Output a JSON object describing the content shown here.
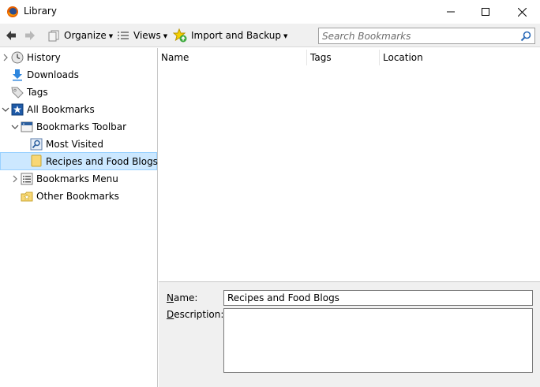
{
  "window": {
    "title": "Library",
    "controls": [
      "minimize",
      "maximize",
      "close"
    ]
  },
  "toolbar": {
    "back_icon": "back-arrow-icon",
    "forward_icon": "forward-arrow-icon",
    "organize_label": "Organize",
    "views_label": "Views",
    "import_label": "Import and Backup",
    "search_placeholder": "Search Bookmarks"
  },
  "tree": {
    "items": [
      {
        "label": "History",
        "icon": "history-clock-icon",
        "twisty": "collapsed"
      },
      {
        "label": "Downloads",
        "icon": "download-arrow-icon",
        "twisty": "none"
      },
      {
        "label": "Tags",
        "icon": "tag-icon",
        "twisty": "none"
      },
      {
        "label": "All Bookmarks",
        "icon": "bookmarks-star-icon",
        "twisty": "expanded"
      },
      {
        "label": "Bookmarks Toolbar",
        "icon": "bookmarks-toolbar-icon",
        "twisty": "expanded"
      },
      {
        "label": "Most Visited",
        "icon": "smart-query-icon",
        "twisty": "none"
      },
      {
        "label": "Recipes and Food Blogs",
        "icon": "folder-icon",
        "twisty": "none",
        "selected": true
      },
      {
        "label": "Bookmarks Menu",
        "icon": "bookmarks-menu-icon",
        "twisty": "collapsed"
      },
      {
        "label": "Other Bookmarks",
        "icon": "other-bookmarks-icon",
        "twisty": "none"
      }
    ]
  },
  "columns": [
    "Name",
    "Tags",
    "Location"
  ],
  "details": {
    "name_label_prefix": "N",
    "name_label_rest": "ame:",
    "name_value": "Recipes and Food Blogs",
    "desc_label_prefix": "D",
    "desc_label_rest": "escription:",
    "desc_value": ""
  },
  "colors": {
    "selection_bg": "#cce8ff",
    "selection_border": "#99d1ff",
    "toolbar_bg": "#f0f0f0",
    "folder_yellow": "#f8d775"
  }
}
